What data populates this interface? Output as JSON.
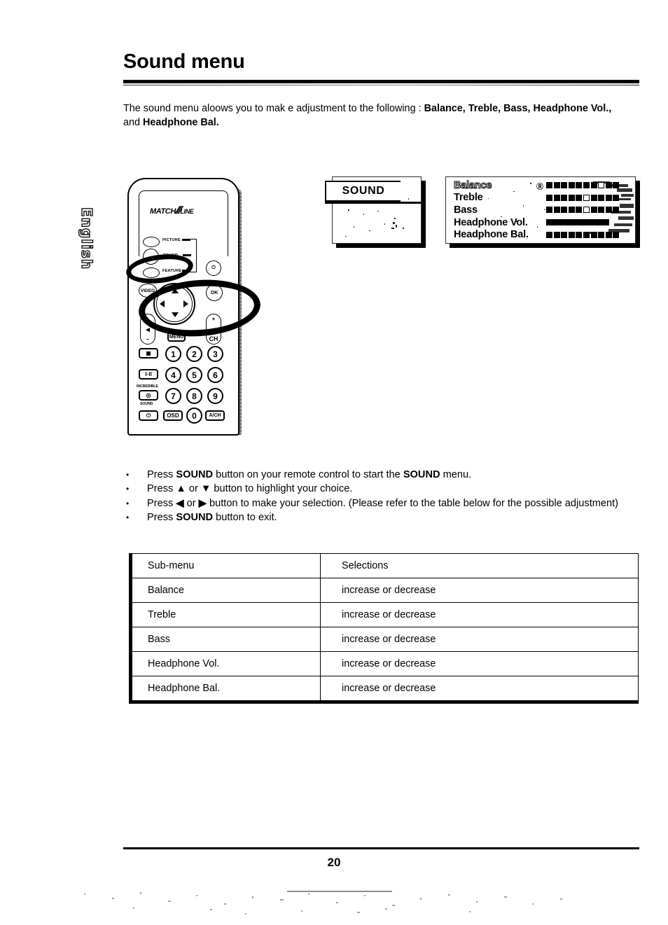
{
  "page": {
    "title": "Sound menu",
    "intro_plain": "The sound menu aloows you to mak e adjustment to the following : Balance, Treble, Bass, Headphone Vol., and Headphone Bal.",
    "intro_lead": "The sound menu aloows you to mak e adjustment to the following : ",
    "intro_bold_1": "Balance, Treble, Bass, Headphone Vol.,",
    "intro_mid": " and ",
    "intro_bold_2": "Headphone Bal.",
    "language_tab": "English",
    "page_number": "20"
  },
  "remote": {
    "brand_left": "MATCH",
    "brand_bars": "///",
    "brand_right": "LINE",
    "mode_buttons": [
      {
        "label": "PICTURE"
      },
      {
        "label": "SOUND"
      },
      {
        "label": "FEATURE"
      }
    ],
    "video_label": "VIDEO",
    "ok_label": "OK",
    "power_icon": "power-icon",
    "volume": {
      "plus": "+",
      "minus": "–",
      "icon": "volume-icon"
    },
    "channel": {
      "plus": "+",
      "label": "CH"
    },
    "menu_label": "MENU",
    "side_buttons": [
      {
        "name": "screen-format-button",
        "label": "▣"
      },
      {
        "name": "dual-sound-button",
        "label": "I·II"
      },
      {
        "name": "incredible-sound-button",
        "label": "◎",
        "caption_top": "INCREDIBLE",
        "caption_bottom": "SOUND"
      },
      {
        "name": "standby-button",
        "label": "⏻"
      }
    ],
    "keypad": [
      "1",
      "2",
      "3",
      "4",
      "5",
      "6",
      "7",
      "8",
      "9"
    ],
    "bottom_row": [
      {
        "name": "osd-button",
        "label": "OSD"
      },
      {
        "name": "zero-button",
        "label": "0"
      },
      {
        "name": "alternate-channel-button",
        "label": "A/CH"
      }
    ],
    "annotations": [
      "sound-button-highlight-ellipse",
      "dpad-highlight-ellipse"
    ]
  },
  "osd": {
    "left_screen": {
      "title": "SOUND"
    },
    "right_screen": {
      "items": [
        {
          "label": "Balance",
          "selected": true,
          "level": 7
        },
        {
          "label": "Treble",
          "selected": false,
          "level": 5
        },
        {
          "label": "Bass",
          "selected": false,
          "level": 5
        },
        {
          "label": "Headphone Vol.",
          "selected": false,
          "level": 9
        },
        {
          "label": "Headphone Bal.",
          "selected": false,
          "level": 8
        }
      ],
      "bar_max": 10
    }
  },
  "instructions": [
    {
      "parts": [
        {
          "t": "Press ",
          "b": false
        },
        {
          "t": "SOUND",
          "b": true
        },
        {
          "t": " button on your remote control to start the ",
          "b": false
        },
        {
          "t": "SOUND",
          "b": true
        },
        {
          "t": " menu.",
          "b": false
        }
      ]
    },
    {
      "parts": [
        {
          "t": "Press ",
          "b": false
        },
        {
          "t": "▲",
          "b": true
        },
        {
          "t": " or ",
          "b": false
        },
        {
          "t": "▼",
          "b": true
        },
        {
          "t": " button to highlight your choice.",
          "b": false
        }
      ]
    },
    {
      "parts": [
        {
          "t": "Press ",
          "b": false
        },
        {
          "t": "◀",
          "b": true
        },
        {
          "t": " or ",
          "b": false
        },
        {
          "t": "▶",
          "b": true
        },
        {
          "t": " button to make your selection. (Please refer to the table below for the possible adjustment)",
          "b": false
        }
      ]
    },
    {
      "parts": [
        {
          "t": "Press ",
          "b": false
        },
        {
          "t": "SOUND",
          "b": true
        },
        {
          "t": " button to exit.",
          "b": false
        }
      ]
    }
  ],
  "table": {
    "headers": [
      "Sub-menu",
      "Selections"
    ],
    "rows": [
      [
        "Balance",
        "increase or decrease"
      ],
      [
        "Treble",
        "increase or decrease"
      ],
      [
        "Bass",
        "increase or decrease"
      ],
      [
        "Headphone Vol.",
        "increase or decrease"
      ],
      [
        "Headphone Bal.",
        "increase or decrease"
      ]
    ]
  }
}
